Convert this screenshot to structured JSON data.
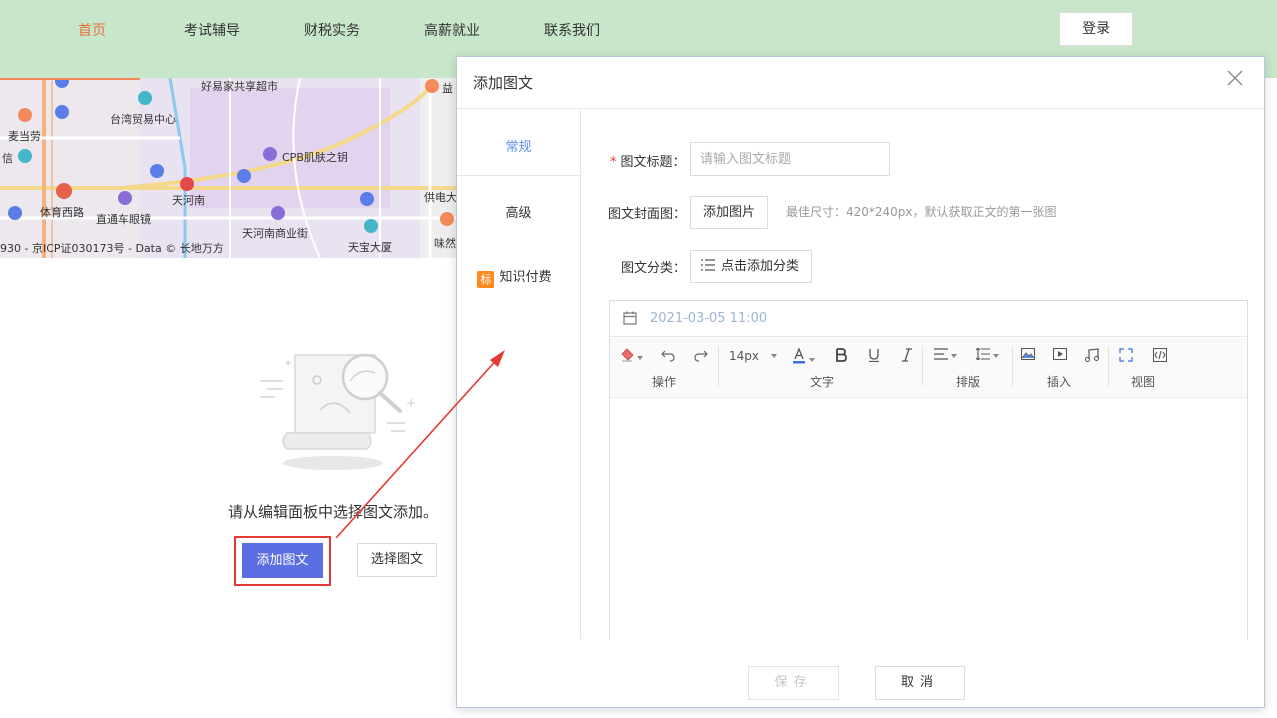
{
  "nav": {
    "items": [
      "首页",
      "考试辅导",
      "财税实务",
      "高薪就业",
      "联系我们"
    ],
    "active_index": 0,
    "login_label": "登录"
  },
  "map": {
    "labels": [
      "好易家共享超市",
      "台湾贸易中心",
      "麦当劳",
      "信",
      "CPB肌肤之钥",
      "天河南",
      "体育西路",
      "直通车眼镜",
      "天河南商业街",
      "天宝大厦",
      "供电大",
      "味然",
      "益"
    ],
    "copyright": "930 - 京ICP证030173号 - Data © 长地万方"
  },
  "empty_state": {
    "message": "请从编辑面板中选择图文添加。",
    "add_label": "添加图文",
    "select_label": "选择图文"
  },
  "dialog": {
    "title": "添加图文",
    "tabs": [
      "常规",
      "高级",
      "知识付费"
    ],
    "tab_badge": "标",
    "form": {
      "title_label": "图文标题：",
      "title_placeholder": "请输入图文标题",
      "cover_label": "图文封面图：",
      "cover_button": "添加图片",
      "cover_hint": "最佳尺寸：420*240px，默认获取正文的第一张图",
      "category_label": "图文分类：",
      "category_button": "点击添加分类"
    },
    "editor": {
      "date": "2021-03-05 11:00",
      "font_size": "14px",
      "groups": [
        "操作",
        "文字",
        "排版",
        "插入",
        "视图"
      ]
    },
    "save_label": "保存",
    "cancel_label": "取消"
  },
  "colors": {
    "nav_bg": "#c8e6c9",
    "nav_active": "#e8733a",
    "primary": "#5b6ee1",
    "highlight": "#e53935",
    "tab_active": "#5b8def",
    "badge": "#ff8a1f"
  }
}
